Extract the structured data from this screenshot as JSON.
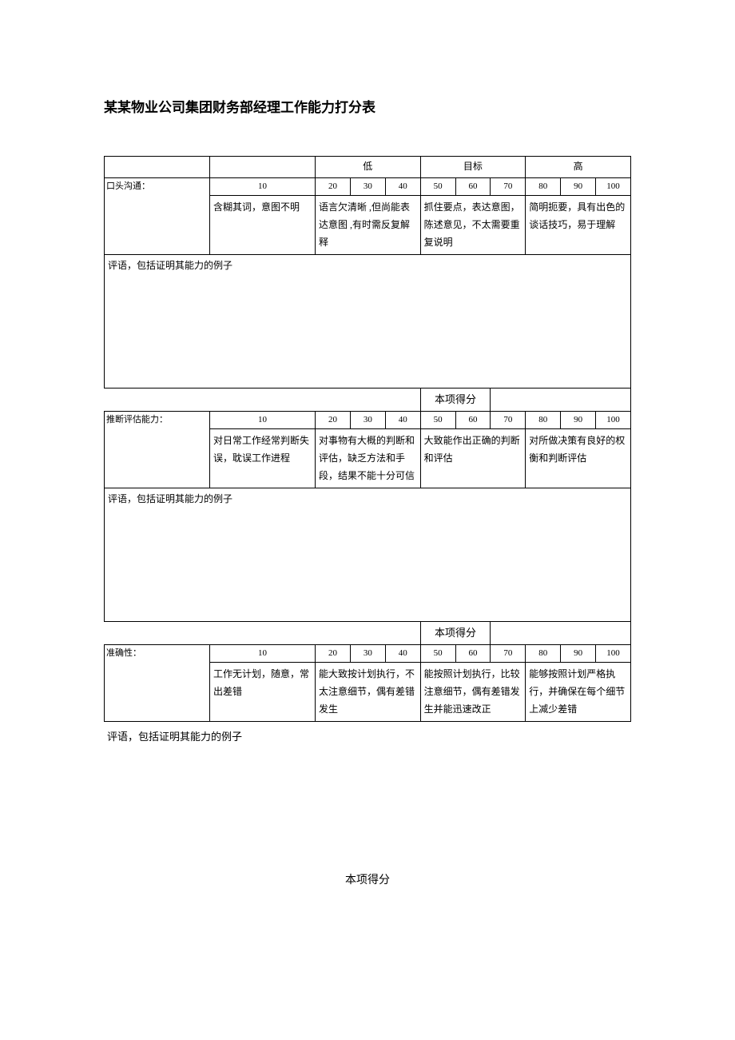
{
  "title": "某某物业公司集团财务部经理工作能力打分表",
  "headers": {
    "blank": "",
    "low": "低",
    "target": "目标",
    "high": "高"
  },
  "scores": [
    "10",
    "20",
    "30",
    "40",
    "50",
    "60",
    "70",
    "80",
    "90",
    "100"
  ],
  "subscore_label": "本项得分",
  "comment_label": "评语，包括证明其能力的例子",
  "sections": [
    {
      "name": "口头沟通：",
      "descs": [
        "含糊其词，意图不明",
        "语言欠清晰 ,但尚能表达意图 ,有时需反复解释",
        "抓住要点，表达意图，陈述意见，不太需要重复说明",
        "简明扼要，具有出色的谈话技巧，易于理解"
      ]
    },
    {
      "name": "推断评估能力：",
      "descs": [
        "对日常工作经常判断失误，耽误工作进程",
        "对事物有大概的判断和评估，缺乏方法和手段，结果不能十分可信",
        "大致能作出正确的判断和评估",
        "对所做决策有良好的权衡和判断评估"
      ]
    },
    {
      "name": "准确性：",
      "descs": [
        "工作无计划，随意，常出差错",
        "能大致按计划执行，不太注意细节，偶有差错发生",
        "能按照计划执行，比较注意细节，偶有差错发生并能迅速改正",
        "能够按照计划严格执行，并确保在每个细节上减少差错"
      ]
    }
  ]
}
